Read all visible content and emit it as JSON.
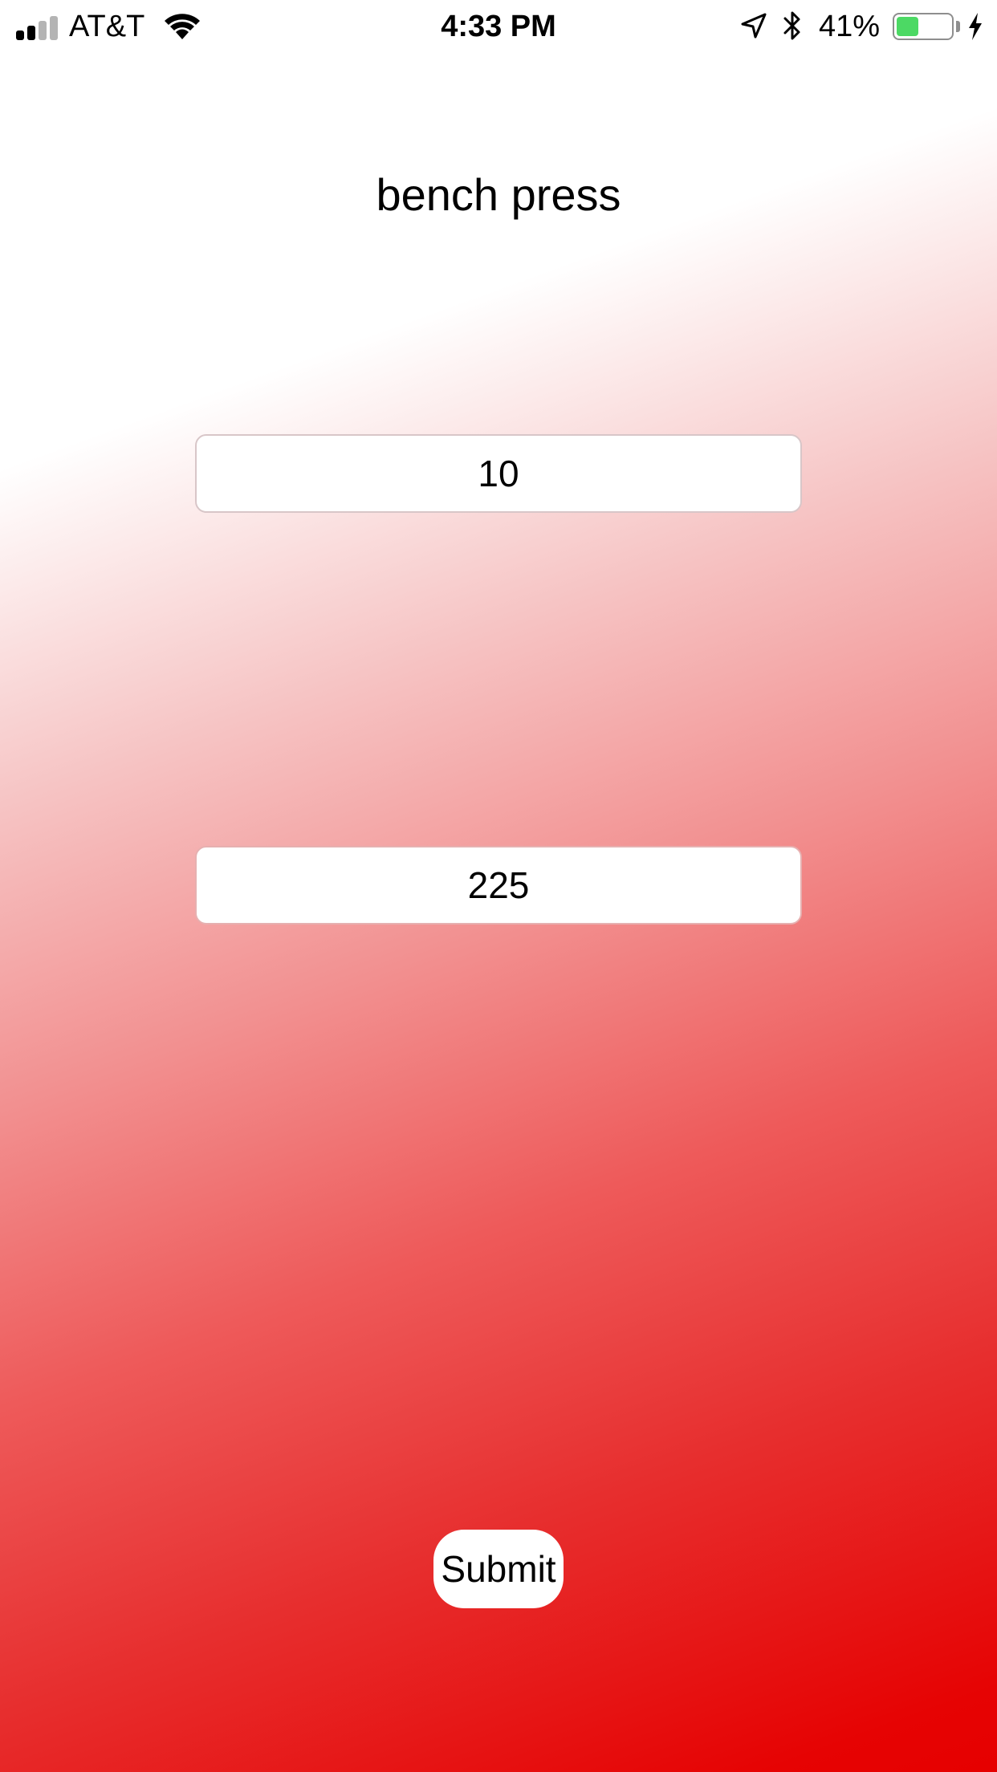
{
  "status_bar": {
    "carrier": "AT&T",
    "time": "4:33 PM",
    "battery_percent_text": "41%",
    "battery_level": 0.41,
    "battery_color": "#4cd964",
    "signal_bars_active": 2,
    "signal_bars_total": 4,
    "icons": [
      "signal-icon",
      "wifi-icon",
      "location-arrow-icon",
      "bluetooth-icon",
      "battery-icon",
      "charging-bolt-icon"
    ]
  },
  "exercise": {
    "title": "bench press"
  },
  "form": {
    "reps_value": "10",
    "weight_value": "225",
    "submit_label": "Submit"
  },
  "colors": {
    "gradient_start": "#ffffff",
    "gradient_end": "#e60000"
  }
}
